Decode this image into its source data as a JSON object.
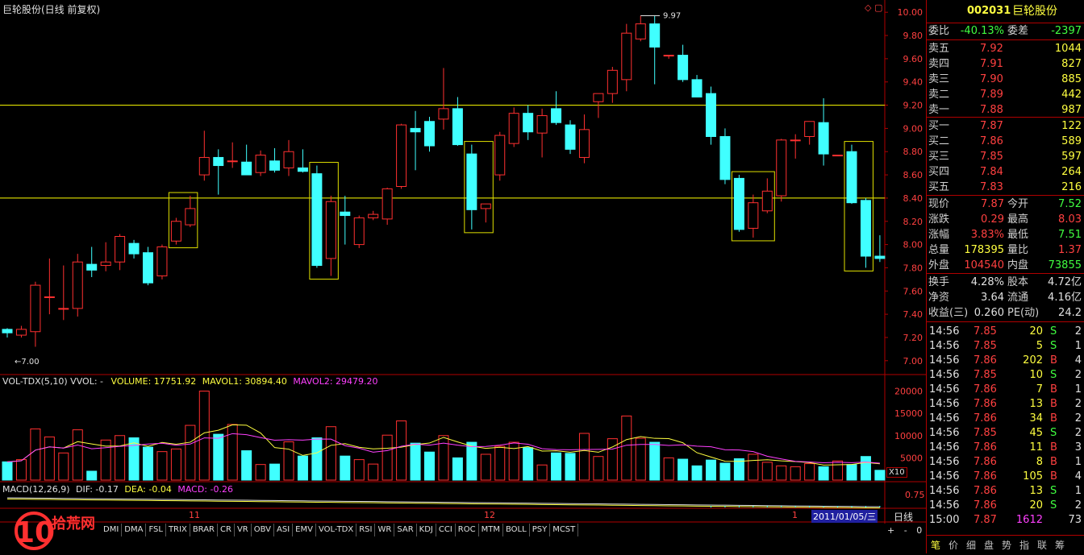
{
  "window": {
    "title": "巨轮股份(日线 前复权)"
  },
  "price_axis": {
    "ticks": [
      "10.00",
      "9.80",
      "9.60",
      "9.40",
      "9.20",
      "9.00",
      "8.80",
      "8.60",
      "8.40",
      "8.20",
      "8.00",
      "7.80",
      "7.60",
      "7.40",
      "7.20",
      "7.00"
    ]
  },
  "annotations": {
    "high_mark": "9.97",
    "low_mark": "7.00"
  },
  "volume_panel": {
    "title": "VOL-TDX(5,10) VVOL: -",
    "volume": "VOLUME: 17751.92",
    "mavol1": "MAVOL1: 30894.40",
    "mavol2": "MAVOL2: 29479.20",
    "ticks": [
      "20000",
      "15000",
      "10000",
      "5000"
    ],
    "unit": "X10"
  },
  "macd_panel": {
    "label": "MACD(12,26,9)",
    "dif": "DIF: -0.17",
    "dea": "DEA: -0.04",
    "macd": "MACD: -0.26",
    "tick": "0.75"
  },
  "date_axis": {
    "m11": "11",
    "m12": "12",
    "m1": "1",
    "current_date": "2011/01/05/三",
    "period": "日线"
  },
  "indicator_tabs": [
    "DMI",
    "DMA",
    "FSL",
    "TRIX",
    "BRAR",
    "CR",
    "VR",
    "OBV",
    "ASI",
    "EMV",
    "VOL-TDX",
    "RSI",
    "WR",
    "SAR",
    "KDJ",
    "CCI",
    "ROC",
    "MTM",
    "BOLL",
    "PSY",
    "MCST"
  ],
  "watermark": {
    "text": "拾荒网"
  },
  "zoom": {
    "plus": "+",
    "minus": "-",
    "zero": "0"
  },
  "colors": {
    "up": "#ff3030",
    "down": "#40ffff",
    "hline": "#ffff00",
    "box": "#e0e000",
    "border": "#b00000"
  },
  "chart_data": {
    "type": "candlestick",
    "ylim": [
      6.95,
      10.05
    ],
    "candles": [
      {
        "o": 7.27,
        "h": 7.28,
        "l": 7.2,
        "c": 7.24
      },
      {
        "o": 7.22,
        "h": 7.3,
        "l": 7.2,
        "c": 7.27
      },
      {
        "o": 7.25,
        "h": 7.68,
        "l": 7.12,
        "c": 7.65
      },
      {
        "o": 7.55,
        "h": 7.88,
        "l": 7.4,
        "c": 7.55
      },
      {
        "o": 7.45,
        "h": 7.82,
        "l": 7.35,
        "c": 7.45
      },
      {
        "o": 7.45,
        "h": 7.92,
        "l": 7.38,
        "c": 7.85
      },
      {
        "o": 7.83,
        "h": 7.98,
        "l": 7.72,
        "c": 7.78
      },
      {
        "o": 7.82,
        "h": 8.02,
        "l": 7.77,
        "c": 7.85
      },
      {
        "o": 7.85,
        "h": 8.09,
        "l": 7.78,
        "c": 8.07
      },
      {
        "o": 8.01,
        "h": 8.04,
        "l": 7.88,
        "c": 7.92
      },
      {
        "o": 7.93,
        "h": 7.98,
        "l": 7.65,
        "c": 7.67
      },
      {
        "o": 7.73,
        "h": 8.0,
        "l": 7.7,
        "c": 7.98
      },
      {
        "o": 8.03,
        "h": 8.23,
        "l": 8.0,
        "c": 8.2
      },
      {
        "o": 8.17,
        "h": 8.42,
        "l": 8.15,
        "c": 8.31
      },
      {
        "o": 8.6,
        "h": 8.98,
        "l": 8.55,
        "c": 8.75
      },
      {
        "o": 8.75,
        "h": 8.82,
        "l": 8.43,
        "c": 8.68
      },
      {
        "o": 8.72,
        "h": 8.88,
        "l": 8.66,
        "c": 8.72
      },
      {
        "o": 8.71,
        "h": 8.86,
        "l": 8.61,
        "c": 8.6
      },
      {
        "o": 8.62,
        "h": 8.81,
        "l": 8.59,
        "c": 8.77
      },
      {
        "o": 8.72,
        "h": 8.83,
        "l": 8.62,
        "c": 8.64
      },
      {
        "o": 8.66,
        "h": 8.9,
        "l": 8.59,
        "c": 8.8
      },
      {
        "o": 8.66,
        "h": 8.82,
        "l": 8.62,
        "c": 8.63
      },
      {
        "o": 8.61,
        "h": 8.68,
        "l": 7.8,
        "c": 7.82
      },
      {
        "o": 7.88,
        "h": 8.42,
        "l": 7.73,
        "c": 8.37
      },
      {
        "o": 8.28,
        "h": 8.42,
        "l": 8.0,
        "c": 8.25
      },
      {
        "o": 8.0,
        "h": 8.25,
        "l": 7.97,
        "c": 8.23
      },
      {
        "o": 8.23,
        "h": 8.29,
        "l": 8.21,
        "c": 8.26
      },
      {
        "o": 8.22,
        "h": 8.49,
        "l": 8.17,
        "c": 8.48
      },
      {
        "o": 8.5,
        "h": 9.04,
        "l": 8.48,
        "c": 9.03
      },
      {
        "o": 9.0,
        "h": 9.15,
        "l": 8.64,
        "c": 8.97
      },
      {
        "o": 9.06,
        "h": 9.1,
        "l": 8.8,
        "c": 8.85
      },
      {
        "o": 9.08,
        "h": 9.52,
        "l": 8.99,
        "c": 9.17
      },
      {
        "o": 9.17,
        "h": 9.27,
        "l": 8.85,
        "c": 8.86
      },
      {
        "o": 8.78,
        "h": 8.86,
        "l": 8.13,
        "c": 8.3
      },
      {
        "o": 8.31,
        "h": 8.35,
        "l": 8.19,
        "c": 8.35
      },
      {
        "o": 8.6,
        "h": 8.97,
        "l": 8.55,
        "c": 8.94
      },
      {
        "o": 8.87,
        "h": 9.18,
        "l": 8.84,
        "c": 9.13
      },
      {
        "o": 9.13,
        "h": 9.2,
        "l": 8.9,
        "c": 8.97
      },
      {
        "o": 8.96,
        "h": 9.17,
        "l": 8.75,
        "c": 9.11
      },
      {
        "o": 9.17,
        "h": 9.32,
        "l": 9.03,
        "c": 9.05
      },
      {
        "o": 9.03,
        "h": 9.07,
        "l": 8.78,
        "c": 8.82
      },
      {
        "o": 8.75,
        "h": 9.12,
        "l": 8.7,
        "c": 8.99
      },
      {
        "o": 9.23,
        "h": 9.3,
        "l": 9.09,
        "c": 9.3
      },
      {
        "o": 9.3,
        "h": 9.53,
        "l": 9.22,
        "c": 9.5
      },
      {
        "o": 9.42,
        "h": 9.9,
        "l": 9.32,
        "c": 9.82
      },
      {
        "o": 9.77,
        "h": 9.97,
        "l": 9.75,
        "c": 9.9
      },
      {
        "o": 9.9,
        "h": 9.97,
        "l": 9.38,
        "c": 9.7
      },
      {
        "o": 9.63,
        "h": 9.63,
        "l": 9.6,
        "c": 9.63
      },
      {
        "o": 9.63,
        "h": 9.72,
        "l": 9.4,
        "c": 9.42
      },
      {
        "o": 9.42,
        "h": 9.46,
        "l": 9.27,
        "c": 9.27
      },
      {
        "o": 9.3,
        "h": 9.36,
        "l": 8.86,
        "c": 8.93
      },
      {
        "o": 8.93,
        "h": 9.0,
        "l": 8.52,
        "c": 8.56
      },
      {
        "o": 8.57,
        "h": 8.6,
        "l": 8.11,
        "c": 8.13
      },
      {
        "o": 8.14,
        "h": 8.43,
        "l": 8.06,
        "c": 8.36
      },
      {
        "o": 8.29,
        "h": 8.57,
        "l": 8.27,
        "c": 8.46
      },
      {
        "o": 8.42,
        "h": 8.91,
        "l": 8.37,
        "c": 8.9
      },
      {
        "o": 8.9,
        "h": 8.95,
        "l": 8.74,
        "c": 8.9
      },
      {
        "o": 8.93,
        "h": 9.06,
        "l": 8.86,
        "c": 9.06
      },
      {
        "o": 9.05,
        "h": 9.26,
        "l": 8.68,
        "c": 8.78
      },
      {
        "o": 8.77,
        "h": 8.77,
        "l": 8.76,
        "c": 8.77
      },
      {
        "o": 8.8,
        "h": 8.86,
        "l": 8.35,
        "c": 8.36
      },
      {
        "o": 8.38,
        "h": 8.4,
        "l": 7.8,
        "c": 7.9
      },
      {
        "o": 7.9,
        "h": 8.08,
        "l": 7.85,
        "c": 7.88
      }
    ],
    "volumes": [
      4100,
      4600,
      11500,
      9700,
      6100,
      11300,
      2000,
      9000,
      10000,
      9500,
      7400,
      6400,
      7000,
      12300,
      20000,
      10300,
      12500,
      6600,
      3500,
      3600,
      8600,
      5400,
      9500,
      12000,
      5400,
      4600,
      3600,
      10100,
      13300,
      8300,
      6300,
      10000,
      5000,
      8500,
      5800,
      7600,
      8500,
      7300,
      3400,
      6100,
      6000,
      10500,
      5300,
      9300,
      14400,
      9400,
      8500,
      5000,
      4700,
      3200,
      4500,
      3800,
      4800,
      5800,
      4000,
      3200,
      3000,
      3700,
      3000,
      4300,
      3500,
      5300,
      2200
    ],
    "horizontal_lines": [
      9.2,
      8.4
    ],
    "highlight_boxes": [
      [
        12,
        13
      ],
      [
        22,
        23
      ],
      [
        33,
        34
      ],
      [
        52,
        54
      ],
      [
        60,
        61
      ]
    ]
  },
  "sidebar": {
    "code": "002031",
    "name": "巨轮股份",
    "webi_label": "委比",
    "webi_value": "-40.13%",
    "weicha_label": "委差",
    "weicha_value": "-2397",
    "sells": [
      {
        "label": "卖五",
        "price": "7.92",
        "vol": "1044"
      },
      {
        "label": "卖四",
        "price": "7.91",
        "vol": "827"
      },
      {
        "label": "卖三",
        "price": "7.90",
        "vol": "885"
      },
      {
        "label": "卖二",
        "price": "7.89",
        "vol": "442"
      },
      {
        "label": "卖一",
        "price": "7.88",
        "vol": "987"
      }
    ],
    "buys": [
      {
        "label": "买一",
        "price": "7.87",
        "vol": "122"
      },
      {
        "label": "买二",
        "price": "7.86",
        "vol": "589"
      },
      {
        "label": "买三",
        "price": "7.85",
        "vol": "597"
      },
      {
        "label": "买四",
        "price": "7.84",
        "vol": "264"
      },
      {
        "label": "买五",
        "price": "7.83",
        "vol": "216"
      }
    ],
    "stats": [
      {
        "l1": "现价",
        "v1": "7.87",
        "c1": "red",
        "l2": "今开",
        "v2": "7.52",
        "c2": "green"
      },
      {
        "l1": "涨跌",
        "v1": "0.29",
        "c1": "red",
        "l2": "最高",
        "v2": "8.03",
        "c2": "red"
      },
      {
        "l1": "涨幅",
        "v1": "3.83%",
        "c1": "red",
        "l2": "最低",
        "v2": "7.51",
        "c2": "green"
      },
      {
        "l1": "总量",
        "v1": "178395",
        "c1": "yellow",
        "l2": "量比",
        "v2": "1.37",
        "c2": "red"
      },
      {
        "l1": "外盘",
        "v1": "104540",
        "c1": "red",
        "l2": "内盘",
        "v2": "73855",
        "c2": "green"
      }
    ],
    "stats2": [
      {
        "l1": "换手",
        "v1": "4.28%",
        "l2": "股本",
        "v2": "4.72亿"
      },
      {
        "l1": "净资",
        "v1": "3.64",
        "l2": "流通",
        "v2": "4.16亿"
      },
      {
        "l1": "收益(三)",
        "v1": "0.260",
        "l2": "PE(动)",
        "v2": "24.2"
      }
    ],
    "ticks": [
      {
        "t": "14:56",
        "p": "7.85",
        "v": "20",
        "s": "S",
        "n": "2"
      },
      {
        "t": "14:56",
        "p": "7.85",
        "v": "5",
        "s": "S",
        "n": "1"
      },
      {
        "t": "14:56",
        "p": "7.86",
        "v": "202",
        "s": "B",
        "n": "4"
      },
      {
        "t": "14:56",
        "p": "7.85",
        "v": "10",
        "s": "S",
        "n": "2"
      },
      {
        "t": "14:56",
        "p": "7.86",
        "v": "7",
        "s": "B",
        "n": "1"
      },
      {
        "t": "14:56",
        "p": "7.86",
        "v": "13",
        "s": "B",
        "n": "2"
      },
      {
        "t": "14:56",
        "p": "7.86",
        "v": "34",
        "s": "B",
        "n": "2"
      },
      {
        "t": "14:56",
        "p": "7.85",
        "v": "45",
        "s": "S",
        "n": "2"
      },
      {
        "t": "14:56",
        "p": "7.86",
        "v": "11",
        "s": "B",
        "n": "3"
      },
      {
        "t": "14:56",
        "p": "7.86",
        "v": "8",
        "s": "B",
        "n": "1"
      },
      {
        "t": "14:56",
        "p": "7.86",
        "v": "105",
        "s": "B",
        "n": "4"
      },
      {
        "t": "14:56",
        "p": "7.86",
        "v": "13",
        "s": "S",
        "n": "1"
      },
      {
        "t": "14:56",
        "p": "7.86",
        "v": "20",
        "s": "S",
        "n": "2"
      },
      {
        "t": "15:00",
        "p": "7.87",
        "v": "1612",
        "s": "",
        "n": "73"
      }
    ],
    "bottom_tabs": [
      "笔",
      "价",
      "细",
      "盘",
      "势",
      "指",
      "联",
      "筹"
    ]
  }
}
